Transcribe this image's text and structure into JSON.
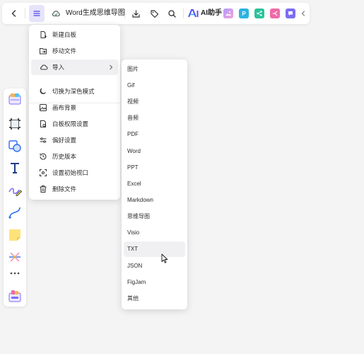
{
  "header": {
    "back_icon": "chevron-left-icon",
    "menu_icon": "hamburger-icon",
    "cloud_icon": "cloud-sync-icon",
    "doc_title": "Word生成思维导图",
    "download_icon": "download-icon",
    "tag_icon": "tag-icon",
    "search_icon": "search-icon",
    "ai_label": "AI助手",
    "app_icons": [
      "image-app-icon",
      "p-app-icon",
      "share-app-icon",
      "mindmap-app-icon",
      "comment-app-icon"
    ],
    "collapse_icon": "chevron-left-icon",
    "brand_color": "#5b4ef5"
  },
  "toolbar": {
    "items": [
      "template-icon",
      "frame-icon",
      "shape-icon",
      "text-icon",
      "pen-icon",
      "connector-icon",
      "sticky-note-icon",
      "mindmap-icon",
      "more-icon",
      "apps-icon"
    ]
  },
  "menu": {
    "items": [
      {
        "label": "新建白板",
        "icon": "new-whiteboard-icon"
      },
      {
        "label": "移动文件",
        "icon": "move-file-icon"
      },
      {
        "label": "导入",
        "icon": "import-cloud-icon"
      },
      {
        "label": "切换为深色模式",
        "icon": "moon-icon"
      },
      {
        "label": "画布背景",
        "icon": "canvas-background-icon"
      },
      {
        "label": "白板权限设置",
        "icon": "permission-icon"
      },
      {
        "label": "偏好设置",
        "icon": "preferences-icon"
      },
      {
        "label": "历史版本",
        "icon": "history-icon"
      },
      {
        "label": "设置初始视口",
        "icon": "viewport-icon"
      },
      {
        "label": "删除文件",
        "icon": "trash-icon"
      }
    ]
  },
  "import_submenu": {
    "items": [
      "图片",
      "Gif",
      "视频",
      "音频",
      "PDF",
      "Word",
      "PPT",
      "Excel",
      "Markdown",
      "思维导图",
      "Visio",
      "TXT",
      "JSON",
      "FigJam",
      "其他"
    ],
    "hovered": "TXT"
  }
}
